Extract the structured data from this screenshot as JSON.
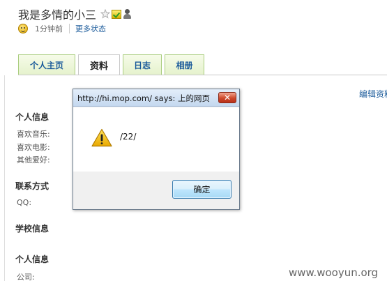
{
  "profile": {
    "title": "我是多情的小三",
    "time_ago": "1分钟前",
    "more_status": "更多状态"
  },
  "tabs": [
    {
      "label": "个人主页",
      "active": false
    },
    {
      "label": "资料",
      "active": true
    },
    {
      "label": "日志",
      "active": false
    },
    {
      "label": "相册",
      "active": false
    }
  ],
  "edit_link": "编辑资料",
  "sections": {
    "personal": {
      "heading": "个人信息",
      "fields": [
        "喜欢音乐:",
        "喜欢电影:",
        "其他爱好:"
      ]
    },
    "contact": {
      "heading": "联系方式",
      "fields": [
        "QQ:"
      ]
    },
    "school": {
      "heading": "学校信息"
    },
    "personal2": {
      "heading": "个人信息",
      "fields": [
        "公司:"
      ]
    }
  },
  "dialog": {
    "title": "http://hi.mop.com/ says: 上的网页",
    "close_glyph": "✕",
    "message": "/22/",
    "ok_label": "确定",
    "icon": "warning-icon"
  },
  "watermark": "www.wooyun.org",
  "colors": {
    "link": "#1a5a9a",
    "tab_border": "#a9cd7e",
    "close_button": "#cf4a2c",
    "warning": "#f5c400"
  }
}
